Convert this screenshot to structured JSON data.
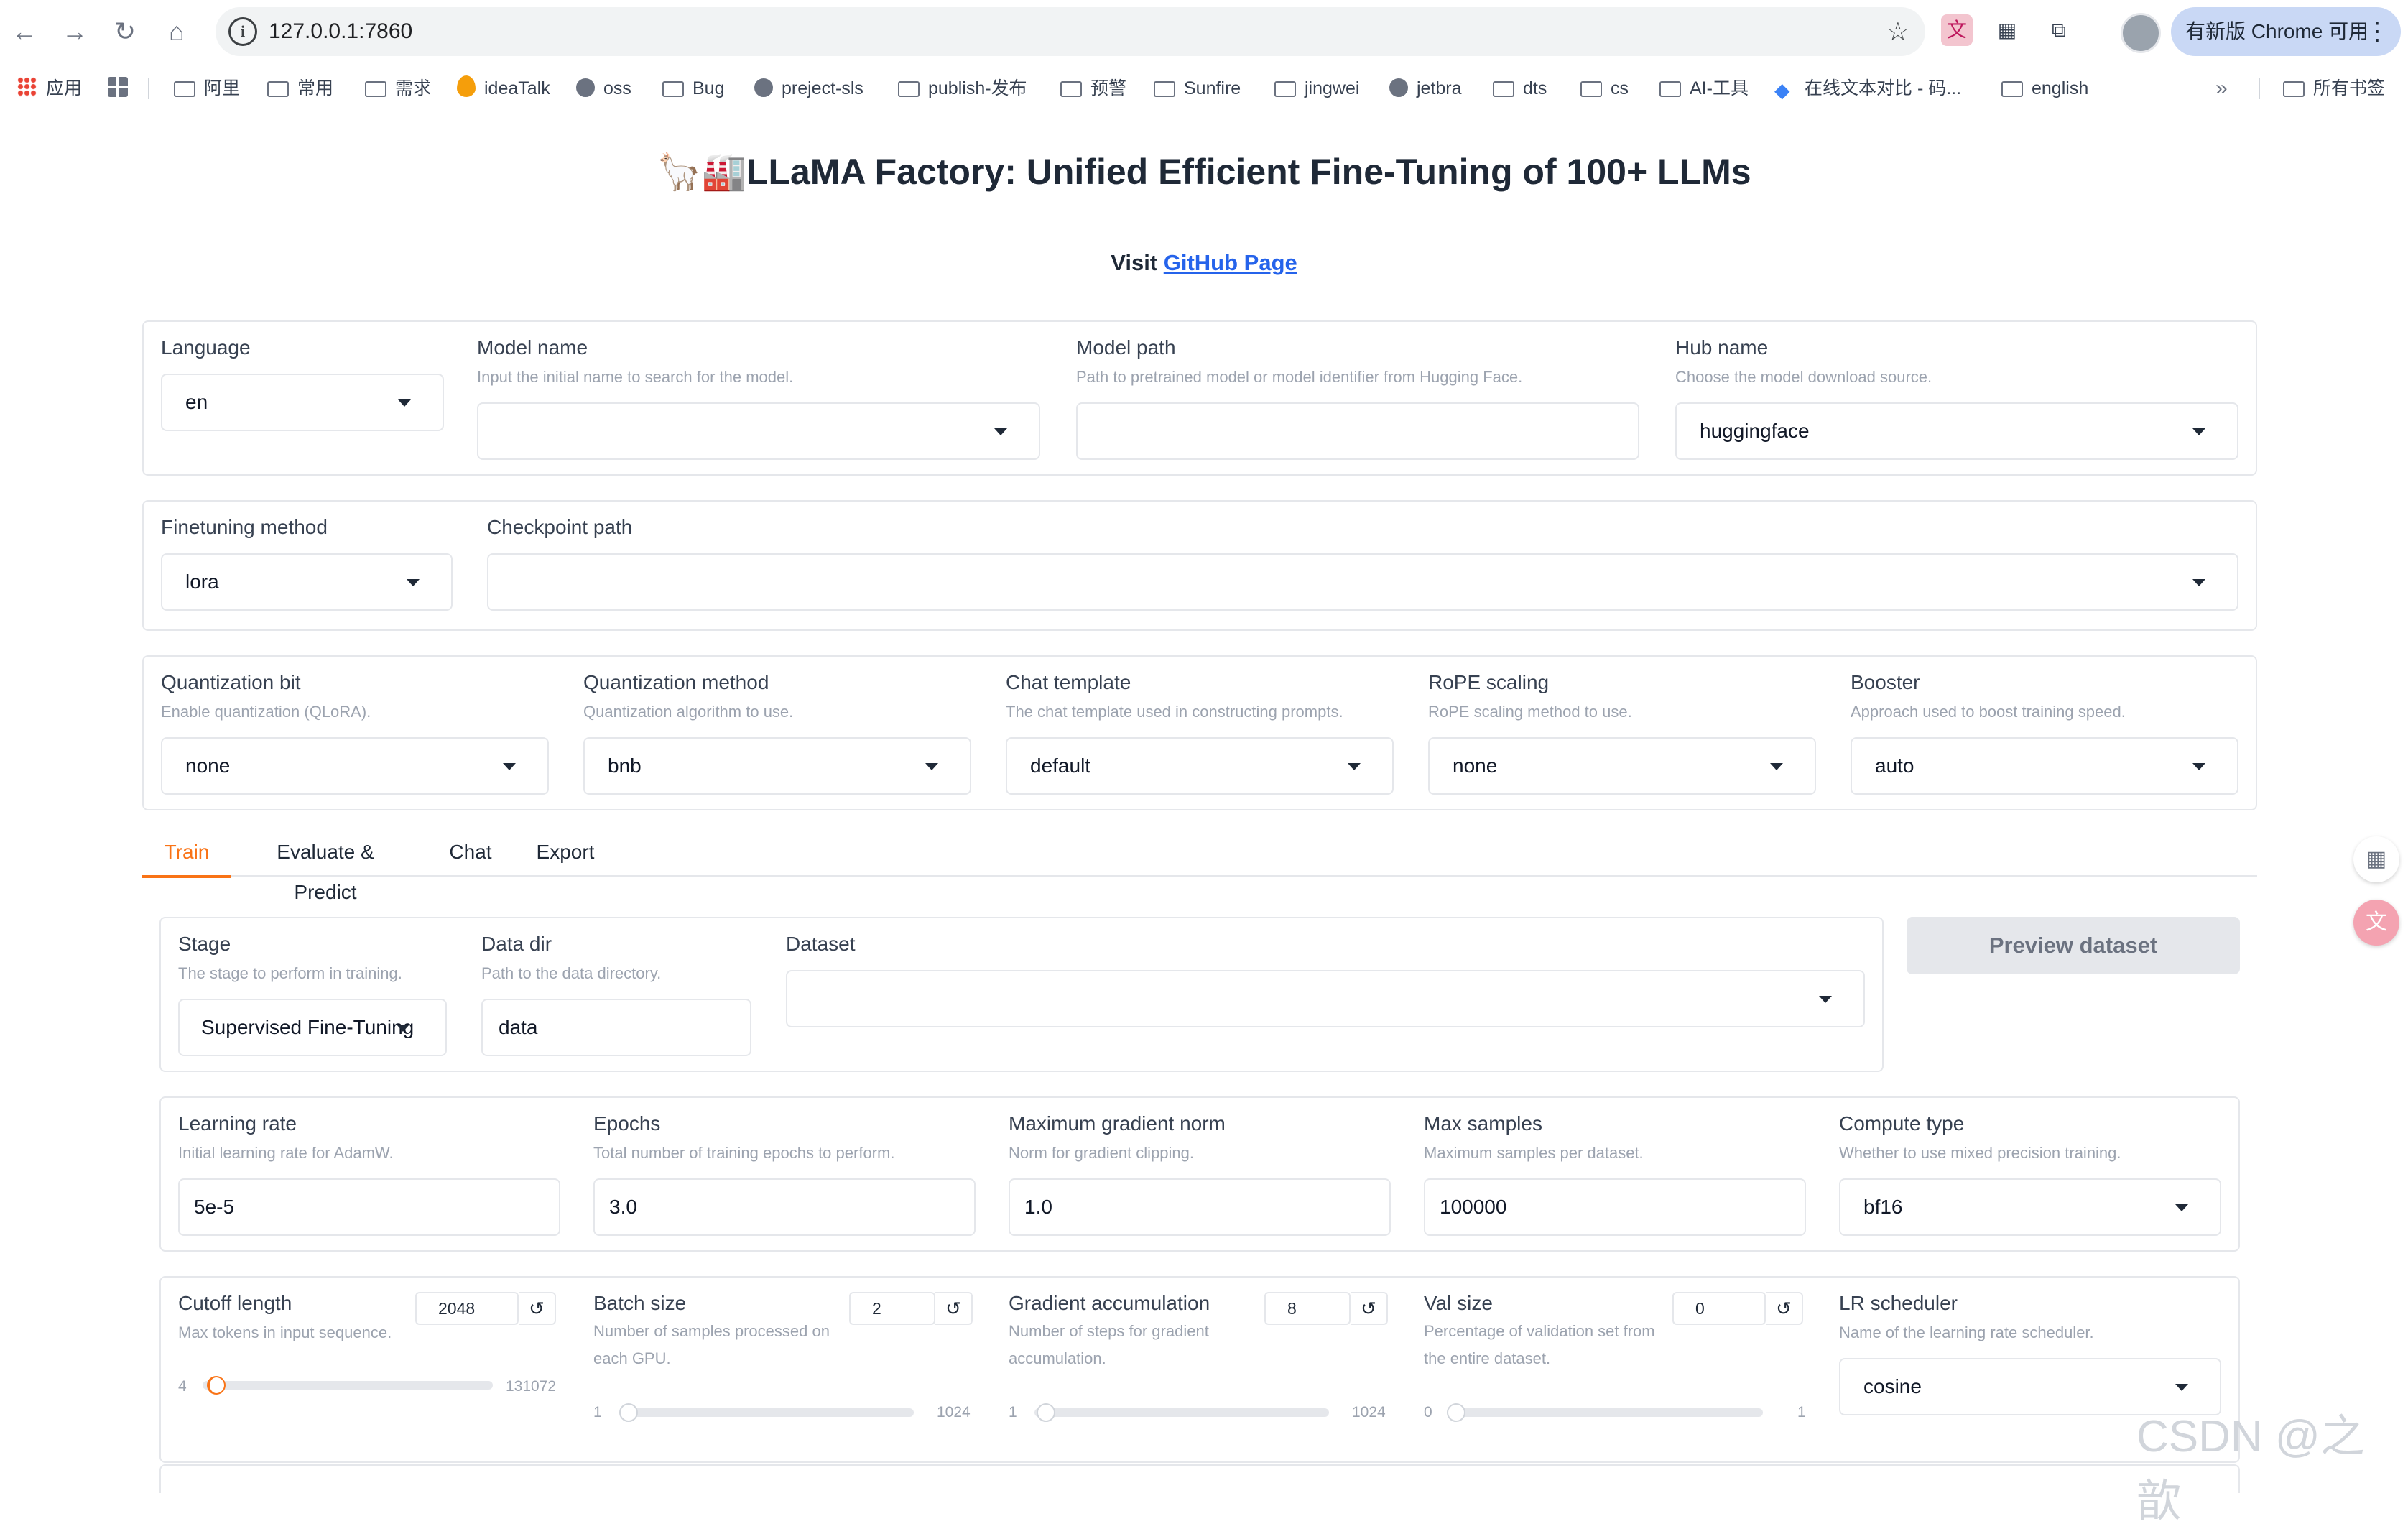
{
  "browser": {
    "url": "127.0.0.1:7860",
    "update_label": "有新版 Chrome 可用",
    "bookmarks": [
      "应用",
      "阿里",
      "常用",
      "需求",
      "ideaTalk",
      "oss",
      "Bug",
      "preject-sls",
      "publish-发布",
      "预警",
      "Sunfire",
      "jingwei",
      "jetbra",
      "dts",
      "cs",
      "AI-工具",
      "在线文本对比 - 码...",
      "english"
    ],
    "all_bookmarks": "所有书签"
  },
  "header": {
    "title": "🦙🏭LLaMA Factory: Unified Efficient Fine-Tuning of 100+ LLMs",
    "visit_prefix": "Visit ",
    "visit_link": "GitHub Page"
  },
  "top": {
    "language": {
      "label": "Language",
      "value": "en"
    },
    "model_name": {
      "label": "Model name",
      "info": "Input the initial name to search for the model.",
      "value": ""
    },
    "model_path": {
      "label": "Model path",
      "info": "Path to pretrained model or model identifier from Hugging Face.",
      "value": ""
    },
    "hub_name": {
      "label": "Hub name",
      "info": "Choose the model download source.",
      "value": "huggingface"
    }
  },
  "method": {
    "finetuning": {
      "label": "Finetuning method",
      "value": "lora"
    },
    "checkpoint": {
      "label": "Checkpoint path",
      "value": ""
    }
  },
  "advanced": {
    "quant_bit": {
      "label": "Quantization bit",
      "info": "Enable quantization (QLoRA).",
      "value": "none"
    },
    "quant_method": {
      "label": "Quantization method",
      "info": "Quantization algorithm to use.",
      "value": "bnb"
    },
    "chat_template": {
      "label": "Chat template",
      "info": "The chat template used in constructing prompts.",
      "value": "default"
    },
    "rope": {
      "label": "RoPE scaling",
      "info": "RoPE scaling method to use.",
      "value": "none"
    },
    "booster": {
      "label": "Booster",
      "info": "Approach used to boost training speed.",
      "value": "auto"
    }
  },
  "tabs": [
    "Train",
    "Evaluate & Predict",
    "Chat",
    "Export"
  ],
  "train": {
    "stage": {
      "label": "Stage",
      "info": "The stage to perform in training.",
      "value": "Supervised Fine-Tuning"
    },
    "data_dir": {
      "label": "Data dir",
      "info": "Path to the data directory.",
      "value": "data"
    },
    "dataset": {
      "label": "Dataset",
      "value": ""
    },
    "preview_button": "Preview dataset",
    "learning_rate": {
      "label": "Learning rate",
      "info": "Initial learning rate for AdamW.",
      "value": "5e-5"
    },
    "epochs": {
      "label": "Epochs",
      "info": "Total number of training epochs to perform.",
      "value": "3.0"
    },
    "max_grad_norm": {
      "label": "Maximum gradient norm",
      "info": "Norm for gradient clipping.",
      "value": "1.0"
    },
    "max_samples": {
      "label": "Max samples",
      "info": "Maximum samples per dataset.",
      "value": "100000"
    },
    "compute_type": {
      "label": "Compute type",
      "info": "Whether to use mixed precision training.",
      "value": "bf16"
    },
    "cutoff": {
      "label": "Cutoff length",
      "info": "Max tokens in input sequence.",
      "value": "2048",
      "min": "4",
      "max": "131072",
      "level": 0.0156
    },
    "batch_size": {
      "label": "Batch size",
      "info": "Number of samples processed on each GPU.",
      "value": "2",
      "min": "1",
      "max": "1024",
      "level": 0.001
    },
    "grad_accum": {
      "label": "Gradient accumulation",
      "info": "Number of steps for gradient accumulation.",
      "value": "8",
      "min": "1",
      "max": "1024",
      "level": 0.007
    },
    "val_size": {
      "label": "Val size",
      "info": "Percentage of validation set from the entire dataset.",
      "value": "0",
      "min": "0",
      "max": "1",
      "level": 0.0
    },
    "lr_scheduler": {
      "label": "LR scheduler",
      "info": "Name of the learning rate scheduler.",
      "value": "cosine"
    }
  },
  "watermark": "CSDN @之歆"
}
